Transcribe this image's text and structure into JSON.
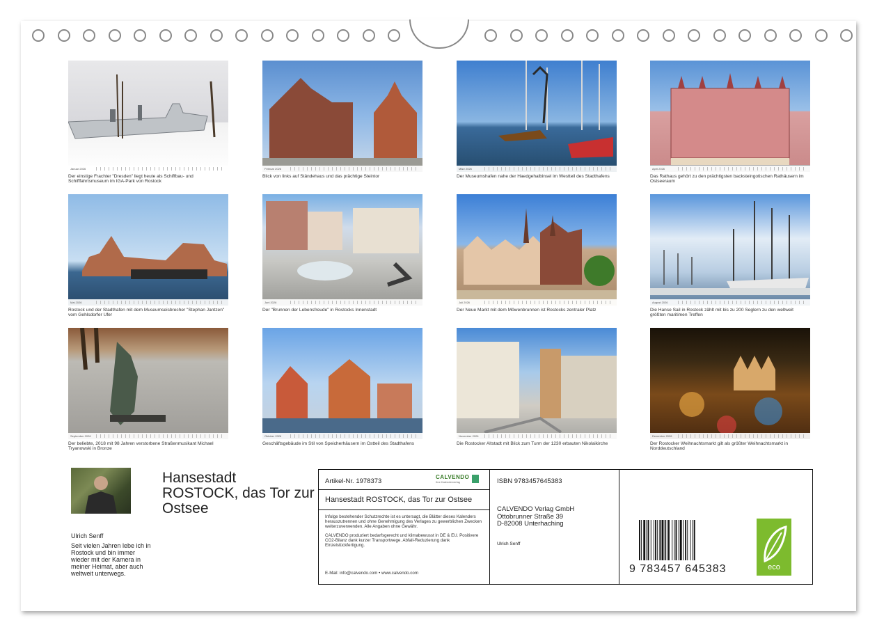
{
  "months": [
    {
      "label": "Januar 2026",
      "caption": "Der einstige Frachter \"Dresden\" liegt heute als Schiffbau- und Schifffahrtsmuseum im IGA-Park von Rostock"
    },
    {
      "label": "Februar 2026",
      "caption": "Blick von links auf Ständehaus und das prächtige Steintor"
    },
    {
      "label": "März 2026",
      "caption": "Der Museumshafen nahe der Haedgehalbinsel im Westteil des Stadthafens"
    },
    {
      "label": "April 2026",
      "caption": "Das Rathaus gehört zu den prächtigsten backsteingotischen Rathäusern im Ostseeraum"
    },
    {
      "label": "Mai 2026",
      "caption": "Rostock und der Stadthafen mit dem Museumseisbrecher \"Stephan Jantzen\" vom Gehlsdorfer Ufer"
    },
    {
      "label": "Juni 2026",
      "caption": "Der \"Brunnen der Lebensfreude\" in Rostocks Innenstadt"
    },
    {
      "label": "Juli 2026",
      "caption": "Der Neue Markt mit dem Möwenbrunnen ist Rostocks zentraler Platz"
    },
    {
      "label": "August 2026",
      "caption": "Die Hanse Sail in Rostock zählt mit bis zu 200 Seglern zu den weltweit größten maritimen Treffen"
    },
    {
      "label": "September 2026",
      "caption": "Der beliebte, 2018 mit 98 Jahren verstorbene Straßenmusikant Michael Tryanowski in Bronze"
    },
    {
      "label": "Oktober 2026",
      "caption": "Geschäftsgebäude im Stil von Speicherhäusern im Ostteil des Stadthafens"
    },
    {
      "label": "November 2026",
      "caption": "Die Rostocker Altstadt mit Blick zum Turm der 1230 erbauten Nikolaikirche"
    },
    {
      "label": "Dezember 2026",
      "caption": "Der Rostocker Weihnachtsmarkt gilt als größter Weihnachtsmarkt in Norddeutschland"
    }
  ],
  "author": {
    "name": "Ulrich Senff",
    "bio": "Seit vielen Jahren lebe ich in Rostock und bin immer wieder mit der Kamera in meiner Heimat, aber auch weltweit unterwegs."
  },
  "title": "Hansestadt ROSTOCK, das Tor zur Ostsee",
  "info": {
    "artikel": "Artikel-Nr. 1978373",
    "brand": "CALVENDO",
    "brand_sub": "Ihre Kalenderverlag",
    "product_title": "Hansestadt ROSTOCK, das Tor zur Ostsee",
    "legal1": "Infolge bestehender Schutzrechte ist es untersagt, die Blätter dieses Kalenders herauszutrennen und ohne Genehmigung des Verlages zu gewerblichen Zwecken weiterzuverwenden. Alle Angaben ohne Gewähr.",
    "legal2": "CALVENDO produziert bedarfsgerecht und klimabewusst in DE & EU. Positivere CO2-Bilanz dank kurzer Transportwege. Abfall-Reduzierung dank Einzelstückfertigung.",
    "email": "E-Mail: info@calvendo.com • www.calvendo.com",
    "isbn": "ISBN 9783457645383",
    "publisher_line1": "CALVENDO Verlag GmbH",
    "publisher_line2": "Ottobrunner Straße 39",
    "publisher_line3": "D-82008 Unterhaching",
    "author_small": "Ulrich Senff",
    "barcode_digits": "9 783457 645383",
    "eco_label": "eco"
  },
  "colors": {
    "eco_green": "#7dbb2e",
    "brand_green": "#3a7d2a"
  }
}
